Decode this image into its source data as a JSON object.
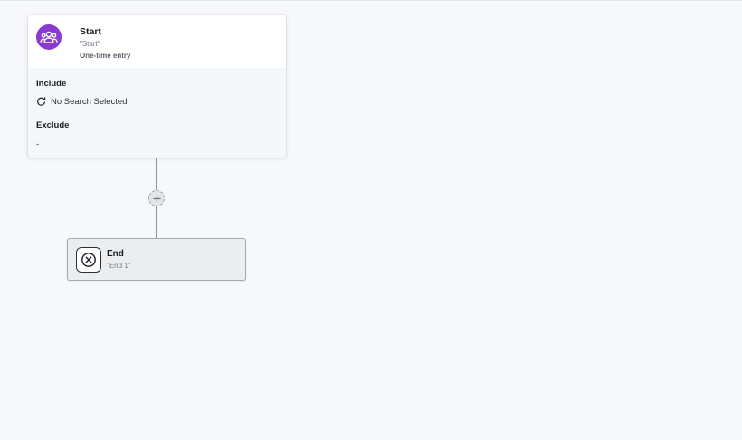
{
  "start_node": {
    "title": "Start",
    "name": "\"Start\"",
    "entry_type": "One-time entry",
    "icon": "users-group-icon",
    "icon_color": "#8a3ad0",
    "include": {
      "label": "Include",
      "value": "No Search Selected",
      "icon": "refresh-icon"
    },
    "exclude": {
      "label": "Exclude",
      "value": "-"
    }
  },
  "connector": {
    "add_icon": "plus-icon"
  },
  "end_node": {
    "title": "End",
    "name": "\"End 1\"",
    "icon": "close-circle-icon"
  }
}
